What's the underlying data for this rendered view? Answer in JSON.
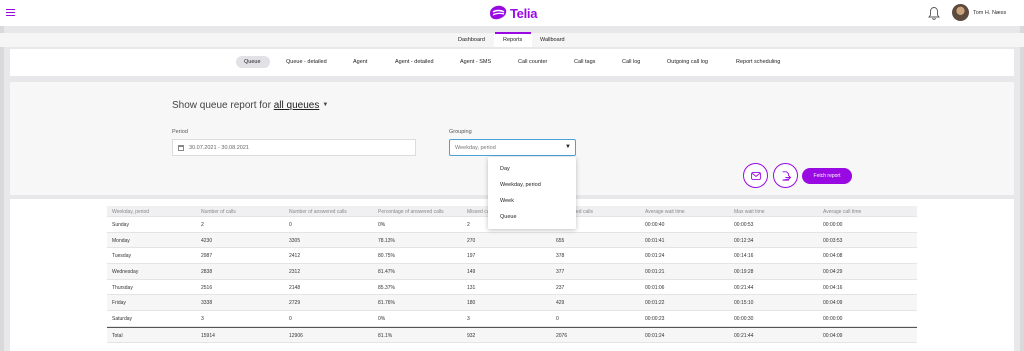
{
  "header": {
    "logo_text": "Telia",
    "user_name": "Tom H. Næss",
    "brand_color": "#990ae3"
  },
  "primary_tabs": [
    {
      "label": "Dashboard",
      "active": false
    },
    {
      "label": "Reports",
      "active": true
    },
    {
      "label": "Wallboard",
      "active": false
    }
  ],
  "report_tabs": [
    {
      "label": "Queue",
      "active": true
    },
    {
      "label": "Queue - detailed",
      "active": false
    },
    {
      "label": "Agent",
      "active": false
    },
    {
      "label": "Agent - detailed",
      "active": false
    },
    {
      "label": "Agent - SMS",
      "active": false
    },
    {
      "label": "Call counter",
      "active": false
    },
    {
      "label": "Call tags",
      "active": false
    },
    {
      "label": "Call log",
      "active": false
    },
    {
      "label": "Outgoing call log",
      "active": false
    },
    {
      "label": "Report scheduling",
      "active": false
    }
  ],
  "form": {
    "heading_prefix": "Show queue report for",
    "heading_target": "all queues",
    "period_label": "Period",
    "period_value": "30.07.2021 - 30.08.2021",
    "grouping_label": "Grouping",
    "grouping_value": "Weekday, period",
    "fetch_label": "Fetch report"
  },
  "grouping_options": [
    "Day",
    "Weekday, period",
    "Week",
    "Queue"
  ],
  "table": {
    "columns": [
      "Weekday, period",
      "Number of calls",
      "Number of answered calls",
      "Percentage of answered calls",
      "Missed calls",
      "Abandoned calls",
      "Average wait time",
      "Max wait time",
      "Average call time"
    ],
    "rows": [
      [
        "Sunday",
        "2",
        "0",
        "0%",
        "2",
        "",
        "00:00:40",
        "00:00:53",
        "00:00:00"
      ],
      [
        "Monday",
        "4230",
        "3305",
        "78.13%",
        "270",
        "655",
        "00:01:41",
        "00:12:34",
        "00:03:53"
      ],
      [
        "Tuesday",
        "2987",
        "2412",
        "80.75%",
        "197",
        "378",
        "00:01:24",
        "00:14:16",
        "00:04:08"
      ],
      [
        "Wednesday",
        "2838",
        "2312",
        "81.47%",
        "149",
        "377",
        "00:01:21",
        "00:19:28",
        "00:04:29"
      ],
      [
        "Thursday",
        "2516",
        "2148",
        "85.37%",
        "131",
        "237",
        "00:01:06",
        "00:21:44",
        "00:04:16"
      ],
      [
        "Friday",
        "3338",
        "2729",
        "81.76%",
        "180",
        "429",
        "00:01:22",
        "00:15:10",
        "00:04:09"
      ],
      [
        "Saturday",
        "3",
        "0",
        "0%",
        "3",
        "0",
        "00:00:23",
        "00:00:30",
        "00:00:00"
      ],
      [
        "Total",
        "15914",
        "12906",
        "81.1%",
        "932",
        "2076",
        "00:01:24",
        "00:21:44",
        "00:04:09"
      ]
    ]
  }
}
